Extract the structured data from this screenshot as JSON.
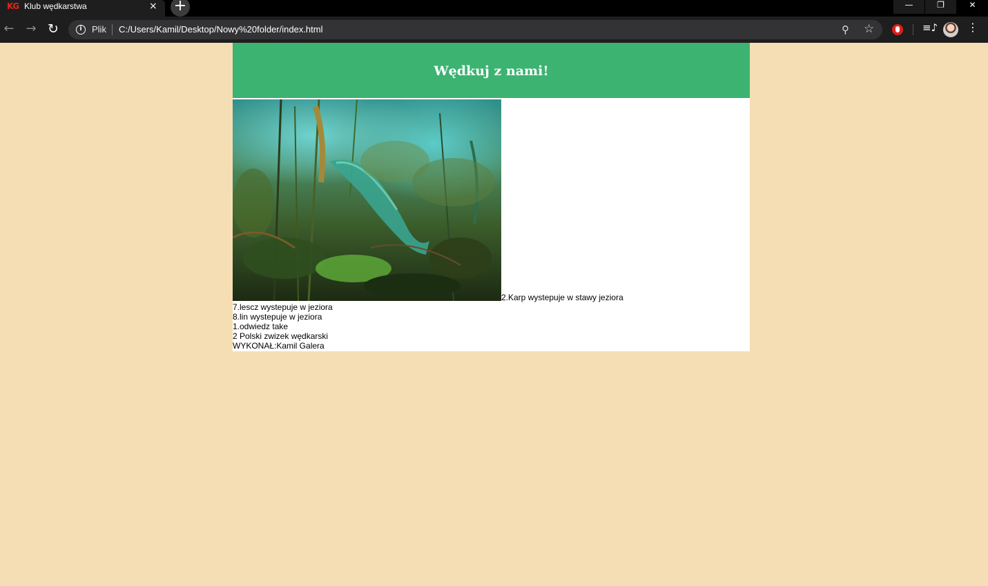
{
  "browser": {
    "tab": {
      "favicon": "KG",
      "title": "Klub wędkarstwa",
      "close_icon": "×"
    },
    "new_tab_icon": "+",
    "window": {
      "minimize": "—",
      "maximize": "❐",
      "close": "✕"
    },
    "nav": {
      "back": "←",
      "forward": "→",
      "reload": "↻"
    },
    "address_bar": {
      "info_icon": "i",
      "scheme_label": "Plik",
      "url": "C:/Users/Kamil/Desktop/Nowy%20folder/index.html"
    },
    "icons": {
      "zoom": "zoom-icon",
      "bookmark": "star-icon",
      "extension": "opera-extension-icon",
      "media": "media-controls-icon",
      "profile": "profile-avatar",
      "menu": "menu-icon"
    }
  },
  "page": {
    "background_color": "#f5deb3",
    "banner": {
      "title": "Wędkuj z nami!",
      "color": "#3cb371"
    },
    "photo_caption": "2.Karp wystepuje w stawy jeziora",
    "lines": [
      "7.lescz wystepuje w jeziora",
      "8.lin wystepuje w jeziora",
      "1.odwiedz take",
      "2 Polski zwizek wędkarski",
      "WYKONAŁ:Kamil Galera"
    ]
  }
}
